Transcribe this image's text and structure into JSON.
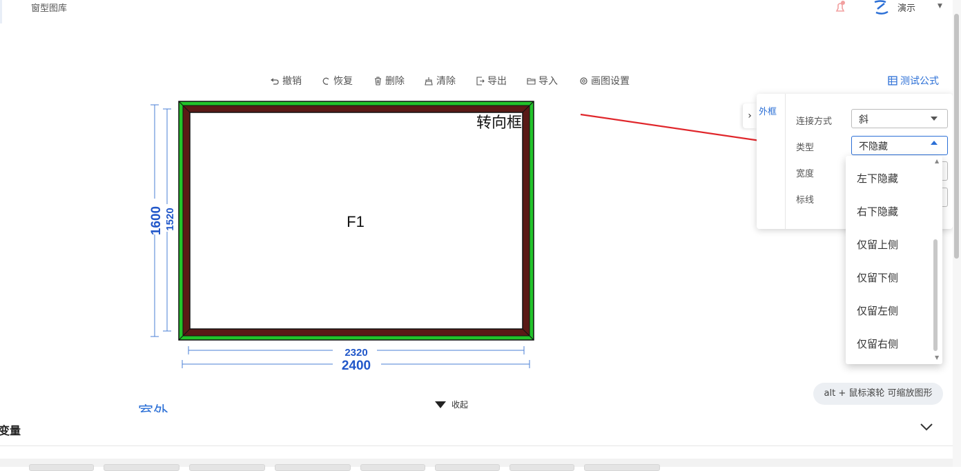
{
  "header": {
    "title": "窗型图库",
    "user": "演示"
  },
  "toolbar": {
    "undo": "撤销",
    "redo": "恢复",
    "delete": "删除",
    "clear": "清除",
    "export": "导出",
    "import": "导入",
    "draw_settings": "画图设置",
    "test_formula": "测试公式"
  },
  "drawing": {
    "pane_label": "F1",
    "corner_label": "转向框",
    "outer_height": "1600",
    "inner_height": "1520",
    "inner_width": "2320",
    "outer_width": "2400",
    "outdoor_label": "室外"
  },
  "panel": {
    "tab": "外框",
    "fields": {
      "connection_label": "连接方式",
      "connection_value": "斜",
      "type_label": "类型",
      "type_value": "不隐藏",
      "width_label": "宽度",
      "mark_label": "标线"
    }
  },
  "dropdown": {
    "options": [
      "左下隐藏",
      "右下隐藏",
      "仅留上侧",
      "仅留下侧",
      "仅留左侧",
      "仅留右侧"
    ]
  },
  "hint": "alt + 鼠标滚轮 可缩放图形",
  "collapse": "收起",
  "variables": {
    "title": "变量"
  },
  "colors": {
    "accent": "#2b6fd6",
    "frame_outer": "#22c32a",
    "frame_inner": "#5a1a16",
    "arrow": "#e0262b"
  }
}
